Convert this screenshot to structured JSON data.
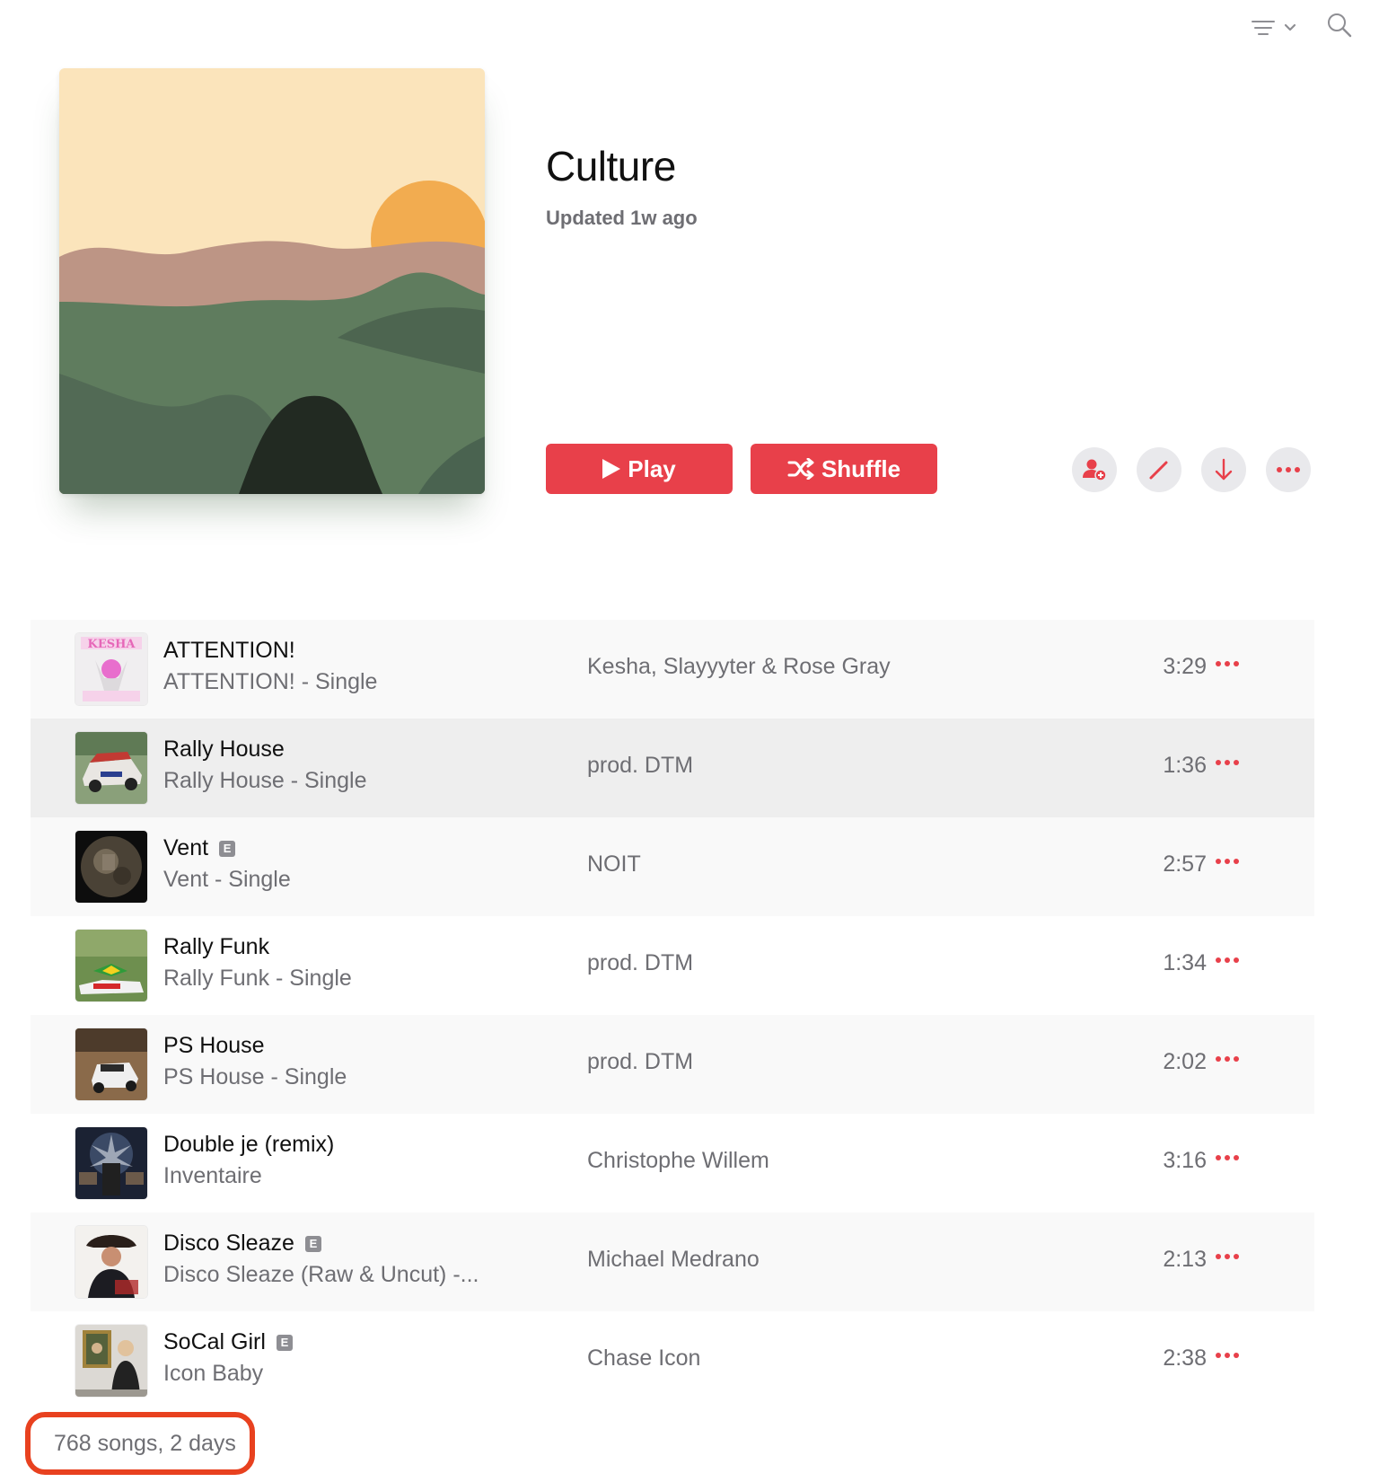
{
  "playlist": {
    "title": "Culture",
    "updated": "Updated 1w ago"
  },
  "buttons": {
    "play_label": "Play",
    "shuffle_label": "Shuffle"
  },
  "toolbar_icons": [
    "list-sort-icon",
    "chevron-down-icon",
    "search-icon"
  ],
  "action_icons": [
    "add-collaborator-icon",
    "pencil-icon",
    "download-icon",
    "more-icon"
  ],
  "colors": {
    "accent": "#e8404a",
    "secondary_text": "#6e6e73",
    "highlight_border": "#e8411f"
  },
  "tracks": [
    {
      "title": "ATTENTION!",
      "album": "ATTENTION! - Single",
      "artist": "Kesha, Slayyyter & Rose Gray",
      "duration": "3:29",
      "explicit": false,
      "art_text": "KESHA"
    },
    {
      "title": "Rally House",
      "album": "Rally House - Single",
      "artist": "prod. DTM",
      "duration": "1:36",
      "explicit": false
    },
    {
      "title": "Vent",
      "album": "Vent - Single",
      "artist": "NOIT",
      "duration": "2:57",
      "explicit": true
    },
    {
      "title": "Rally Funk",
      "album": "Rally Funk - Single",
      "artist": "prod. DTM",
      "duration": "1:34",
      "explicit": false
    },
    {
      "title": "PS House",
      "album": "PS House - Single",
      "artist": "prod. DTM",
      "duration": "2:02",
      "explicit": false
    },
    {
      "title": "Double je (remix)",
      "album": "Inventaire",
      "artist": "Christophe Willem",
      "duration": "3:16",
      "explicit": false
    },
    {
      "title": "Disco Sleaze",
      "album": "Disco Sleaze (Raw & Uncut) -...",
      "artist": "Michael Medrano",
      "duration": "2:13",
      "explicit": true
    },
    {
      "title": "SoCal Girl",
      "album": "Icon Baby",
      "artist": "Chase Icon",
      "duration": "2:38",
      "explicit": true
    }
  ],
  "explicit_badge": "E",
  "summary": "768 songs, 2 days"
}
